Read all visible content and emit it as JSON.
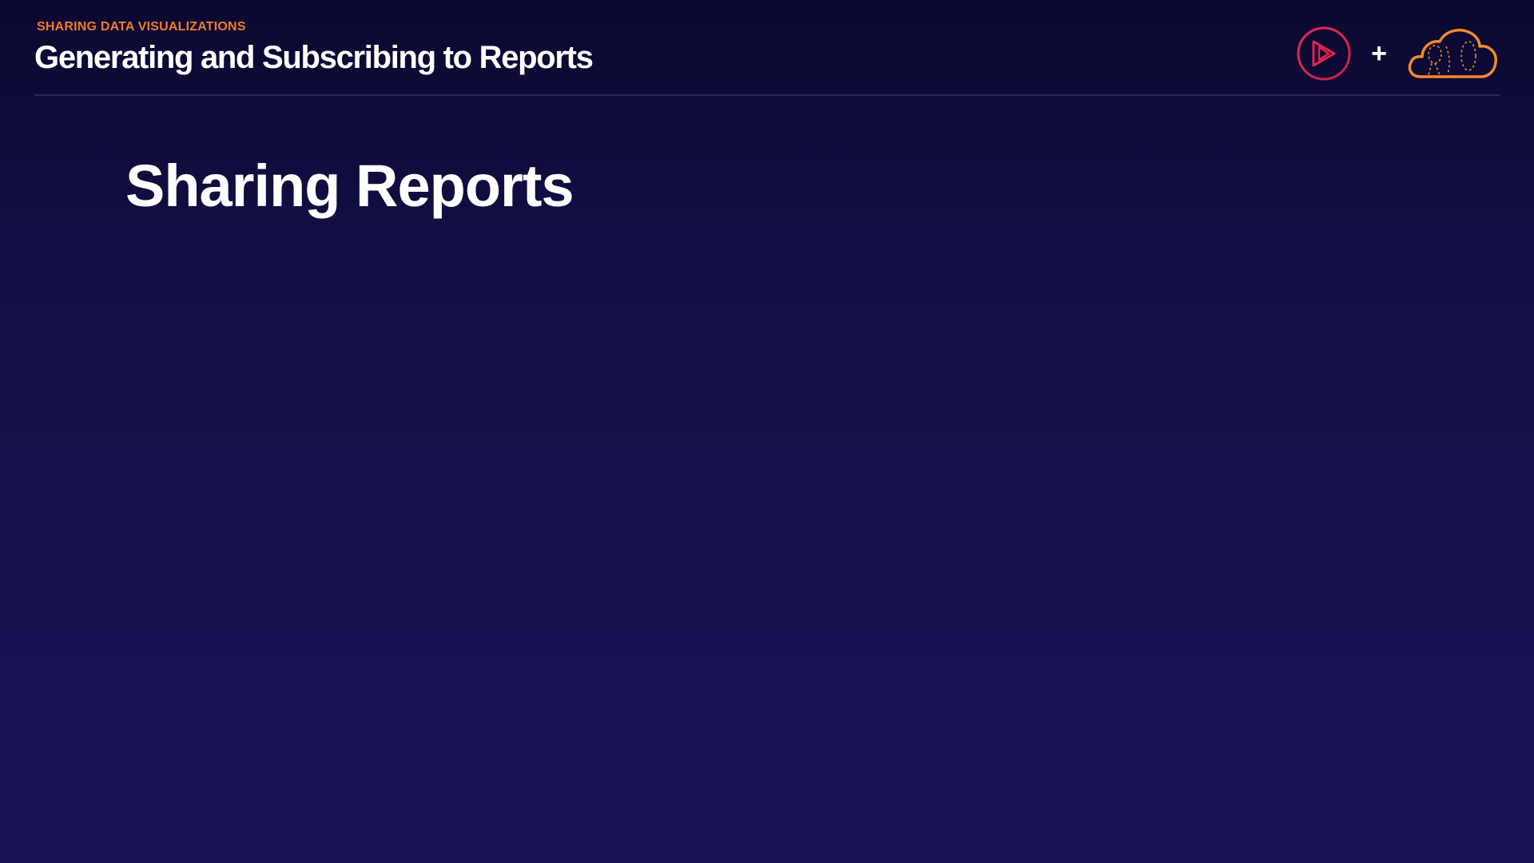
{
  "header": {
    "eyebrow": "SHARING DATA VISUALIZATIONS",
    "course_title": "Generating and Subscribing to Reports"
  },
  "logos": {
    "play_logo_icon": "play-circle-icon",
    "play_logo_color": "#e0254f",
    "plus_text": "+",
    "cloud_logo_icon": "cloud-icon",
    "cloud_logo_color": "#f08a28"
  },
  "main": {
    "section_title": "Sharing Reports"
  },
  "colors": {
    "accent": "#f07a2e",
    "background_top": "#0b0830",
    "background_bottom": "#1a1456"
  }
}
